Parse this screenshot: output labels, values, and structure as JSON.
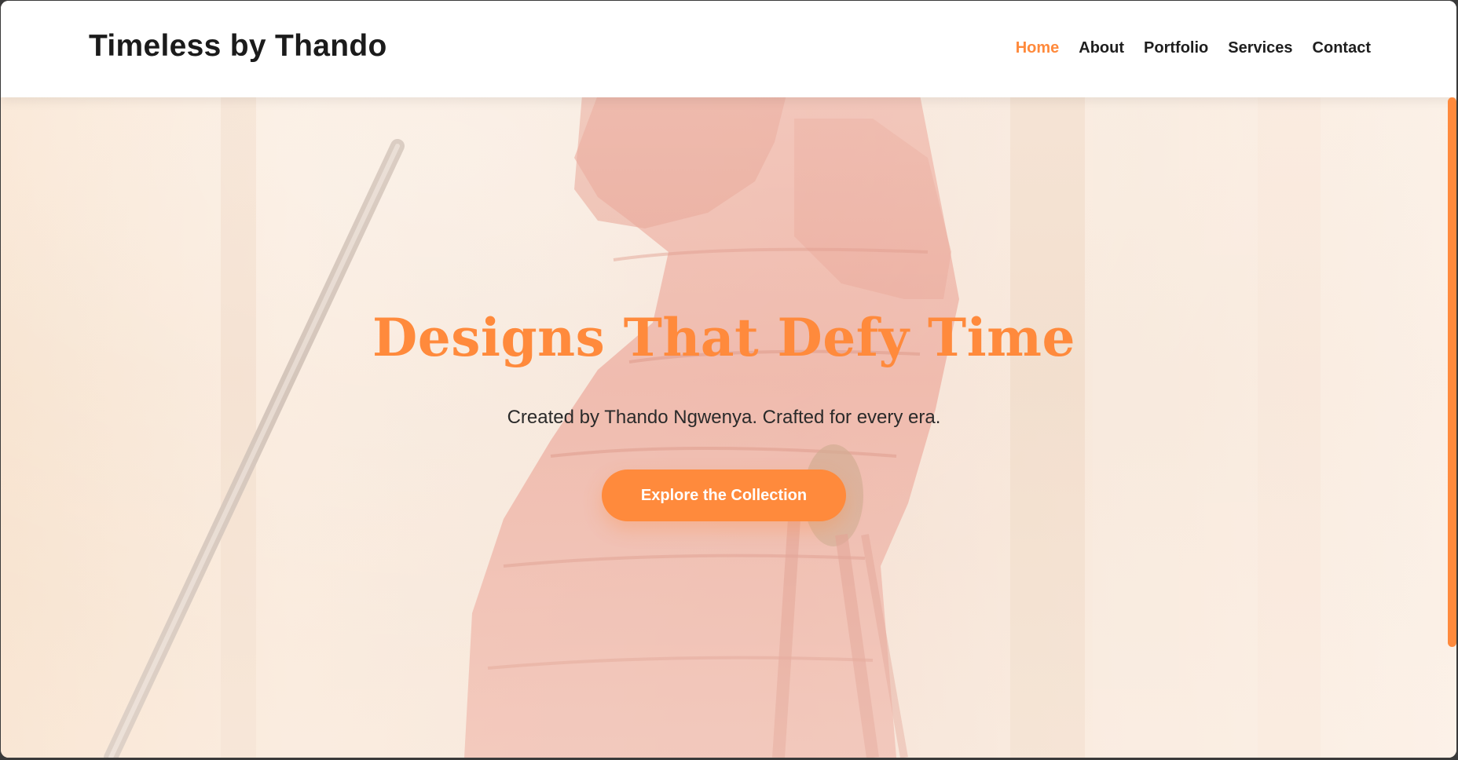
{
  "header": {
    "brand": "Timeless by Thando",
    "nav": [
      {
        "label": "Home",
        "active": true
      },
      {
        "label": "About",
        "active": false
      },
      {
        "label": "Portfolio",
        "active": false
      },
      {
        "label": "Services",
        "active": false
      },
      {
        "label": "Contact",
        "active": false
      }
    ]
  },
  "hero": {
    "title": "Designs That Defy Time",
    "subtitle": "Created by Thando Ngwenya. Crafted for every era.",
    "cta_label": "Explore the Collection"
  },
  "colors": {
    "accent": "#ff8a3c",
    "text_dark": "#1e1e1e",
    "header_bg": "#ffffff"
  }
}
